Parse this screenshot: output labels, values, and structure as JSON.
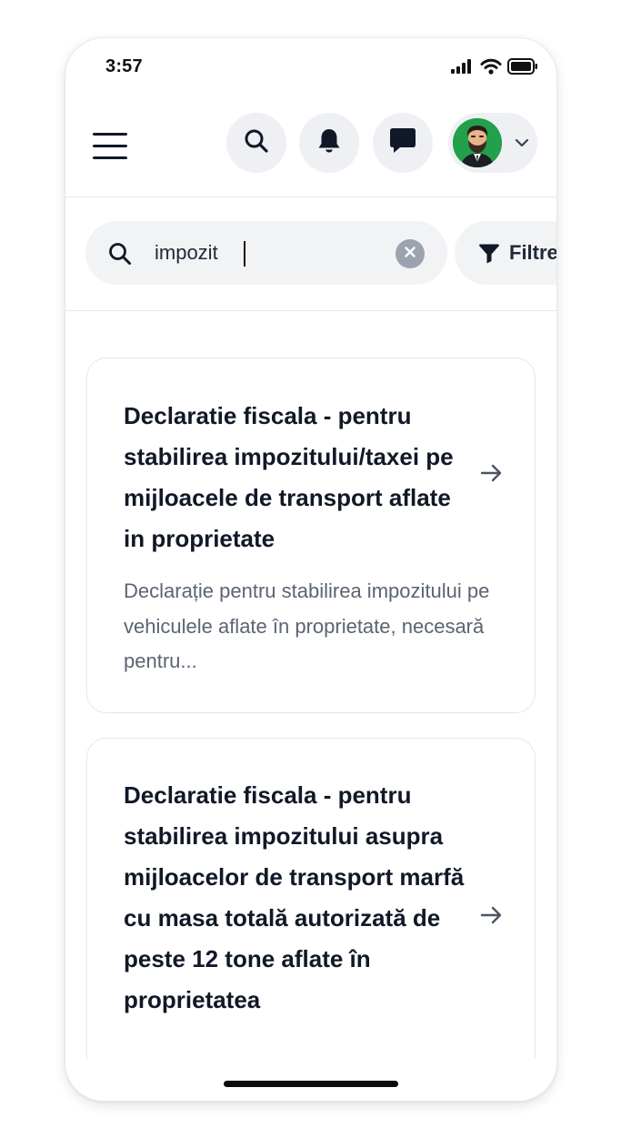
{
  "status_bar": {
    "time": "3:57",
    "icons": [
      "signal-icon",
      "wifi-icon",
      "battery-icon"
    ]
  },
  "header": {
    "menu_icon": "hamburger-menu-icon",
    "actions": [
      "search-icon",
      "bell-icon",
      "chat-icon"
    ],
    "avatar_icon": "avatar",
    "avatar_bg": "#22a04b"
  },
  "search": {
    "value": "impozit",
    "clear_icon": "clear-icon",
    "filter_label": "Filtre",
    "filter_icon": "filter-icon"
  },
  "results": [
    {
      "title": "Declaratie fiscala - pentru stabilirea impozitului/taxei pe mijloacele de transport aflate in proprietate",
      "description": "Declarație pentru stabilirea impozitului pe vehiculele aflate în proprietate, necesară pentru..."
    },
    {
      "title": "Declaratie fiscala - pentru stabilirea impozitului asupra mijloacelor de transport marfă cu masa totală autorizată de peste 12 tone aflate în proprietatea",
      "description": ""
    }
  ],
  "colors": {
    "text_primary": "#111827",
    "text_secondary": "#5b6472",
    "chip_bg": "#eef0f3",
    "border": "#e3e6ea"
  }
}
